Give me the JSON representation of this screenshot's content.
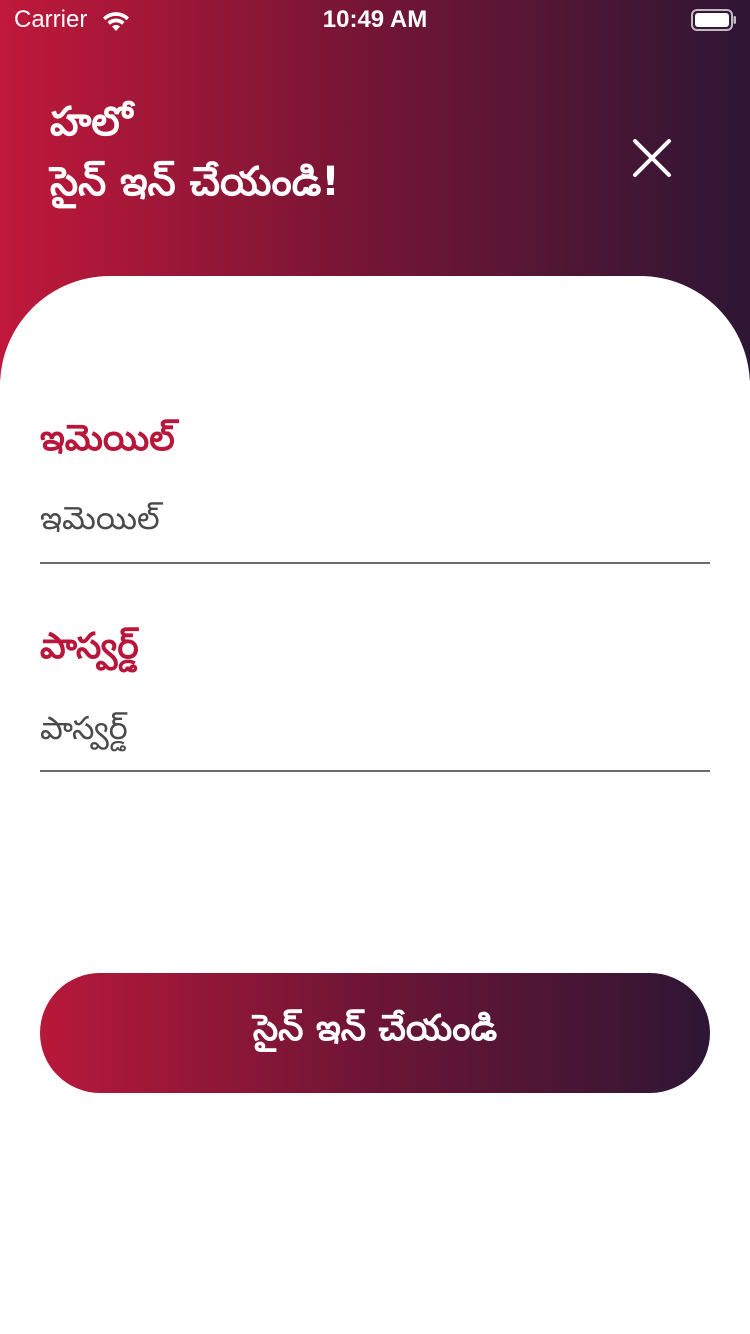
{
  "status_bar": {
    "carrier": "Carrier",
    "time": "10:49 AM",
    "wifi_icon": "wifi-icon",
    "battery_icon": "battery-icon"
  },
  "header": {
    "greeting_line1": "హలో",
    "greeting_line2": "సైన్ ఇన్ చేయండి!",
    "close_icon": "close-icon",
    "gradient_start": "#c0183a",
    "gradient_end": "#2d1634"
  },
  "form": {
    "email": {
      "label": "ఇమెయిల్",
      "placeholder": "ఇమెయిల్",
      "value": ""
    },
    "password": {
      "label": "పాస్వర్డ్",
      "placeholder": "పాస్వర్డ్",
      "value": ""
    },
    "label_color": "#b8163a"
  },
  "signin_button": {
    "label": "సైన్ ఇన్ చేయండి"
  }
}
